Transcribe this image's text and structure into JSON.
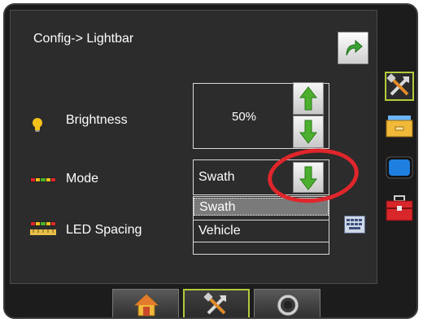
{
  "header": {
    "title": "Config-> Lightbar",
    "back_icon": "return-arrow-icon"
  },
  "settings": {
    "brightness": {
      "label": "Brightness",
      "value": "50%",
      "icon": "lightbulb-icon"
    },
    "mode": {
      "label": "Mode",
      "value": "Swath",
      "icon": "lightbar-icon",
      "options": [
        "Swath",
        "Vehicle"
      ],
      "selected": "Swath"
    },
    "led_spacing": {
      "label": "LED Spacing",
      "icon": "led-spacing-icon"
    }
  },
  "side_nav": [
    "tools-icon",
    "folder-icon",
    "monitor-icon",
    "toolbox-icon"
  ],
  "bottom_nav": [
    "home-icon",
    "tools-icon",
    "gauge-icon"
  ],
  "colors": {
    "accent": "#b4c93a",
    "highlight": "#e0262b",
    "arrow_green": "#4caf2e"
  }
}
